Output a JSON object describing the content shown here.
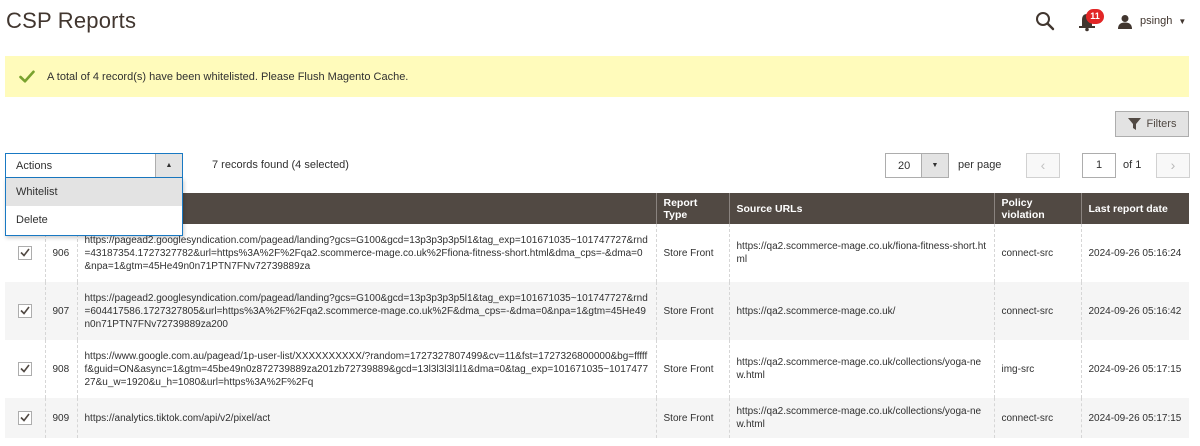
{
  "header": {
    "title": "CSP Reports",
    "notifications_count": "11",
    "user_name": "psingh"
  },
  "message": {
    "text": "A total of 4 record(s) have been whitelisted. Please Flush Magento Cache."
  },
  "toolbar": {
    "filters_label": "Filters",
    "actions_label": "Actions",
    "actions_options": [
      "Whitelist",
      "Delete"
    ],
    "records_text": "7 records found (4 selected)",
    "per_page_value": "20",
    "per_page_label": "per page",
    "current_page": "1",
    "of_pages": "of 1"
  },
  "table": {
    "columns": [
      "Report Type",
      "Source URLs",
      "Policy violation",
      "Last report date"
    ],
    "rows": [
      {
        "checked": true,
        "id": "906",
        "blocked_uri": "https://pagead2.googlesyndication.com/pagead/landing?gcs=G100&gcd=13p3p3p3p5l1&tag_exp=101671035~101747727&rnd=43187354.1727327782&url=https%3A%2F%2Fqa2.scommerce-mage.co.uk%2Ffiona-fitness-short.html&dma_cps=-&dma=0&npa=1&gtm=45He49n0n71PTN7FNv72739889za",
        "report_type": "Store Front",
        "source_url": "https://qa2.scommerce-mage.co.uk/fiona-fitness-short.html",
        "policy": "connect-src",
        "date": "2024-09-26 05:16:24"
      },
      {
        "checked": true,
        "id": "907",
        "blocked_uri": "https://pagead2.googlesyndication.com/pagead/landing?gcs=G100&gcd=13p3p3p3p5l1&tag_exp=101671035~101747727&rnd=604417586.1727327805&url=https%3A%2F%2Fqa2.scommerce-mage.co.uk%2F&dma_cps=-&dma=0&npa=1&gtm=45He49n0n71PTN7FNv72739889za200",
        "report_type": "Store Front",
        "source_url": "https://qa2.scommerce-mage.co.uk/",
        "policy": "connect-src",
        "date": "2024-09-26 05:16:42"
      },
      {
        "checked": true,
        "id": "908",
        "blocked_uri": "https://www.google.com.au/pagead/1p-user-list/XXXXXXXXXX/?random=1727327807499&cv=11&fst=1727326800000&bg=ffffff&guid=ON&async=1&gtm=45be49n0z872739889za201zb72739889&gcd=13l3l3l3l1l1&dma=0&tag_exp=101671035~101747727&u_w=1920&u_h=1080&url=https%3A%2F%2Fq",
        "report_type": "Store Front",
        "source_url": "https://qa2.scommerce-mage.co.uk/collections/yoga-new.html",
        "policy": "img-src",
        "date": "2024-09-26 05:17:15"
      },
      {
        "checked": true,
        "id": "909",
        "blocked_uri": "https://analytics.tiktok.com/api/v2/pixel/act",
        "report_type": "Store Front",
        "source_url": "https://qa2.scommerce-mage.co.uk/collections/yoga-new.html",
        "policy": "connect-src",
        "date": "2024-09-26 05:17:15"
      }
    ]
  },
  "colors": {
    "table_header_bg": "#514943",
    "message_bg": "#fffbbb",
    "success_check": "#79a22e",
    "badge": "#e22626",
    "focus_border": "#1979c3"
  },
  "icons": [
    "search-icon",
    "bell-icon",
    "user-icon",
    "caret-down-icon",
    "check-icon",
    "funnel-icon",
    "chevron-left-icon",
    "chevron-right-icon"
  ]
}
